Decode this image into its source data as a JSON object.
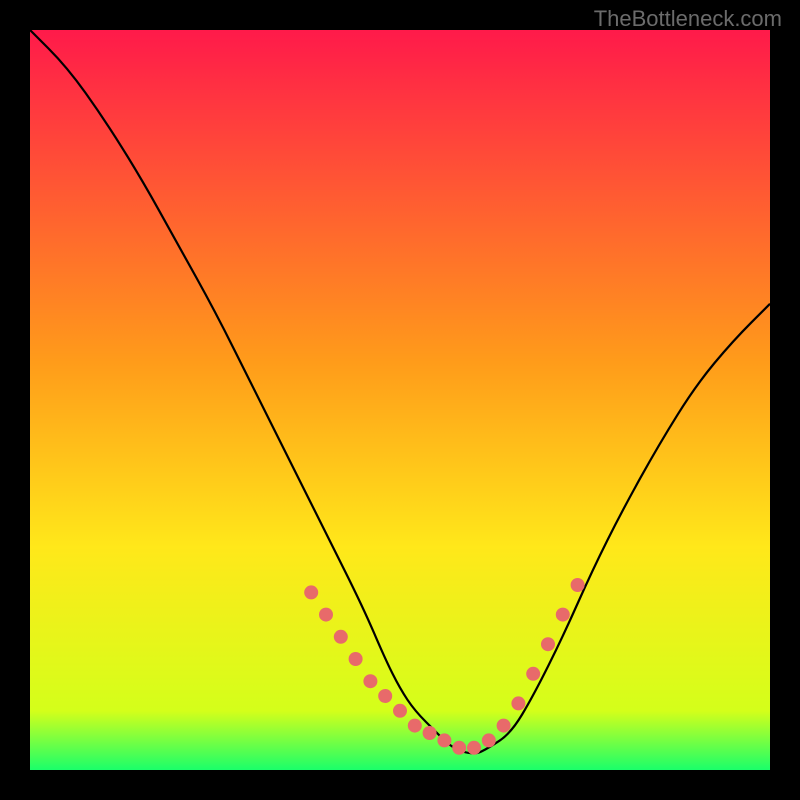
{
  "watermark": "TheBottleneck.com",
  "chart_data": {
    "type": "line",
    "title": "",
    "xlabel": "",
    "ylabel": "",
    "xlim": [
      0,
      100
    ],
    "ylim": [
      0,
      100
    ],
    "grid": false,
    "legend": false,
    "gradient_stops": [
      {
        "offset": 0,
        "color": "#ff1a4a"
      },
      {
        "offset": 0.45,
        "color": "#ff9c1a"
      },
      {
        "offset": 0.7,
        "color": "#ffe81a"
      },
      {
        "offset": 0.92,
        "color": "#d4ff1a"
      },
      {
        "offset": 1.0,
        "color": "#1aff6a"
      }
    ],
    "series": [
      {
        "name": "bottleneck-curve",
        "x": [
          0,
          5,
          10,
          15,
          20,
          25,
          30,
          35,
          40,
          45,
          48,
          50,
          52,
          55,
          57,
          60,
          62,
          65,
          68,
          72,
          76,
          80,
          85,
          90,
          95,
          100
        ],
        "y": [
          100,
          95,
          88,
          80,
          71,
          62,
          52,
          42,
          32,
          22,
          15,
          11,
          8,
          5,
          3,
          2,
          3,
          5,
          10,
          18,
          27,
          35,
          44,
          52,
          58,
          63
        ]
      }
    ],
    "highlighted_points": {
      "name": "highlight-dots",
      "color": "#e86a6a",
      "points": [
        {
          "x": 38,
          "y": 24
        },
        {
          "x": 40,
          "y": 21
        },
        {
          "x": 42,
          "y": 18
        },
        {
          "x": 44,
          "y": 15
        },
        {
          "x": 46,
          "y": 12
        },
        {
          "x": 48,
          "y": 10
        },
        {
          "x": 50,
          "y": 8
        },
        {
          "x": 52,
          "y": 6
        },
        {
          "x": 54,
          "y": 5
        },
        {
          "x": 56,
          "y": 4
        },
        {
          "x": 58,
          "y": 3
        },
        {
          "x": 60,
          "y": 3
        },
        {
          "x": 62,
          "y": 4
        },
        {
          "x": 64,
          "y": 6
        },
        {
          "x": 66,
          "y": 9
        },
        {
          "x": 68,
          "y": 13
        },
        {
          "x": 70,
          "y": 17
        },
        {
          "x": 72,
          "y": 21
        },
        {
          "x": 74,
          "y": 25
        }
      ]
    }
  }
}
